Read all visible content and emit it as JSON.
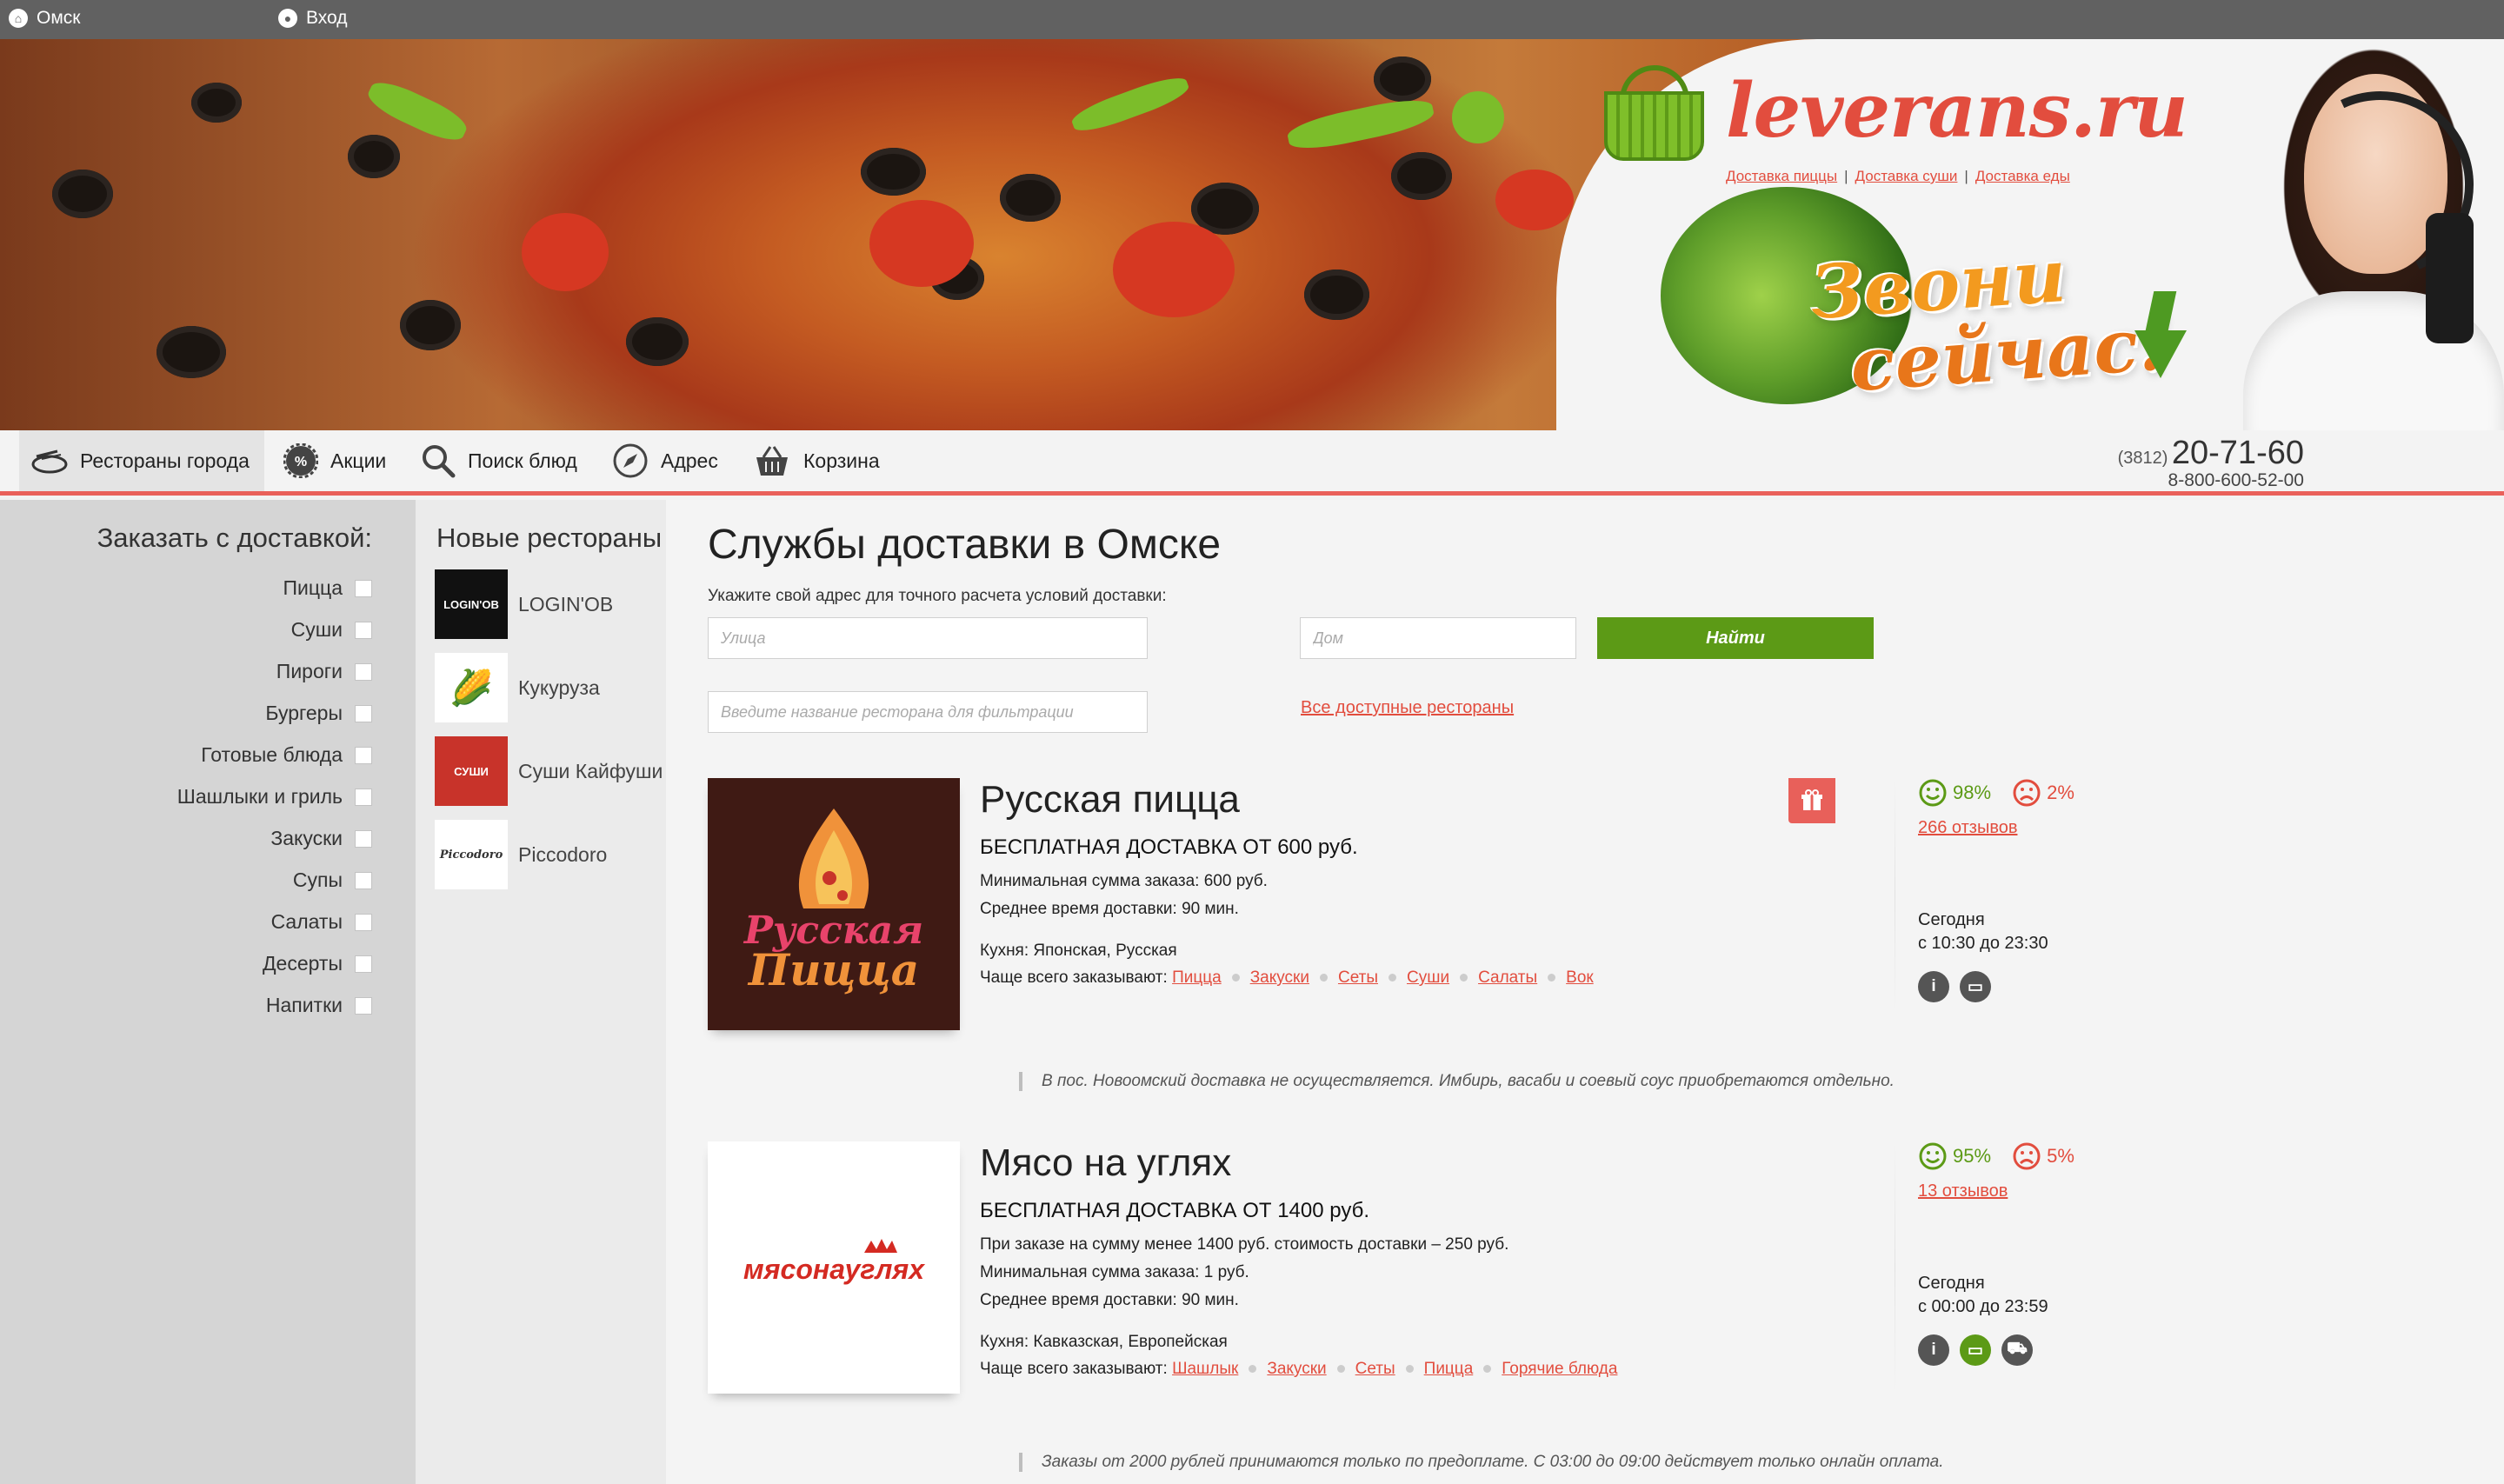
{
  "topbar": {
    "city": "Омск",
    "login": "Вход"
  },
  "banner": {
    "logo": "leverans.ru",
    "links": [
      "Доставка пиццы",
      "Доставка суши",
      "Доставка еды"
    ],
    "call_line1": "Звони",
    "call_line2": "сейчас!"
  },
  "nav": {
    "items": [
      {
        "label": "Рестораны города",
        "icon": "plate-icon"
      },
      {
        "label": "Акции",
        "icon": "percent-icon"
      },
      {
        "label": "Поиск блюд",
        "icon": "search-icon"
      },
      {
        "label": "Адрес",
        "icon": "compass-icon"
      },
      {
        "label": "Корзина",
        "icon": "basket-icon"
      }
    ],
    "phone_code": "(3812)",
    "phone": "20-71-60",
    "phone_alt": "8-800-600-52-00"
  },
  "filters": {
    "title": "Заказать с доставкой:",
    "categories": [
      "Пицца",
      "Суши",
      "Пироги",
      "Бургеры",
      "Готовые блюда",
      "Шашлыки и гриль",
      "Закуски",
      "Супы",
      "Салаты",
      "Десерты",
      "Напитки"
    ]
  },
  "new_restaurants": {
    "title": "Новые рестораны",
    "items": [
      {
        "name": "LOGIN'OB",
        "thumb_text": "LOGIN'OB"
      },
      {
        "name": "Кукуруза",
        "thumb_text": "🌽"
      },
      {
        "name": "Суши Кайфуши",
        "thumb_text": "СУШИ"
      },
      {
        "name": "Piccodoro",
        "thumb_text": "Piccodoro"
      }
    ]
  },
  "main": {
    "title": "Службы доставки в Омске",
    "hint": "Укажите свой адрес для точного расчета условий доставки:",
    "street_placeholder": "Улица",
    "house_placeholder": "Дом",
    "find_label": "Найти",
    "filter_placeholder": "Введите название ресторана для фильтрации",
    "all_link": "Все доступные рестораны"
  },
  "restaurants": [
    {
      "name": "Русская пицца",
      "logo_text_1": "Русская",
      "logo_text_2": "Пицца",
      "free_delivery": "БЕСПЛАТНАЯ ДОСТАВКА ОТ 600 руб.",
      "lines": [
        "Минимальная сумма заказа: 600 руб.",
        "Среднее время доставки: 90 мин."
      ],
      "cuisine": "Кухня: Японская, Русская",
      "often_label": "Чаще всего заказывают:",
      "often": [
        "Пицца",
        "Закуски",
        "Сеты",
        "Суши",
        "Салаты",
        "Вок"
      ],
      "positive": "98%",
      "negative": "2%",
      "reviews": "266 отзывов",
      "day": "Сегодня",
      "hours": "с 10:30 до 23:30",
      "note": "В пос. Новоомский доставка не осуществляется. Имбирь, васаби и соевый соус приобретаются отдельно."
    },
    {
      "name": "Мясо на углях",
      "logo_text_1": "мясонауглях",
      "free_delivery": "БЕСПЛАТНАЯ ДОСТАВКА ОТ 1400 руб.",
      "lines": [
        "При заказе на сумму менее 1400 руб. стоимость доставки – 250 руб.",
        "Минимальная сумма заказа: 1 руб.",
        "Среднее время доставки: 90 мин."
      ],
      "cuisine": "Кухня: Кавказская, Европейская",
      "often_label": "Чаще всего заказывают:",
      "often": [
        "Шашлык",
        "Закуски",
        "Сеты",
        "Пицца",
        "Горячие блюда"
      ],
      "positive": "95%",
      "negative": "5%",
      "reviews": "13 отзывов",
      "day": "Сегодня",
      "hours": "с 00:00 до 23:59",
      "note": "Заказы от 2000 рублей принимаются только по предоплате. С 03:00 до 09:00 действует только онлайн оплата."
    }
  ]
}
